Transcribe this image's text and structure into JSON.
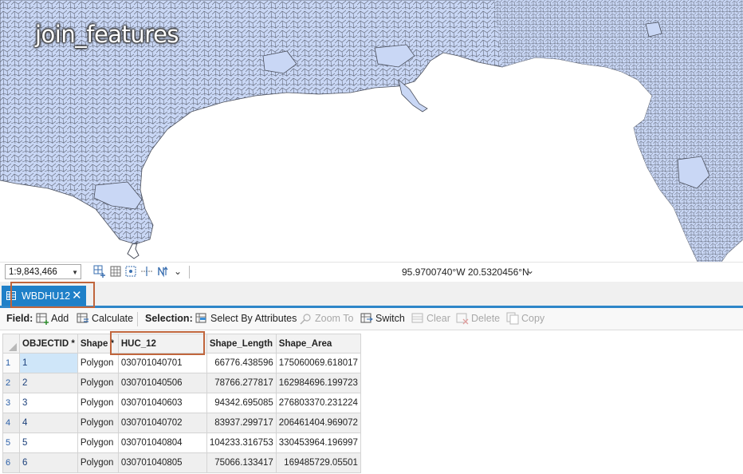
{
  "map": {
    "title": "join_features"
  },
  "statusbar": {
    "scale": "1:9,843,466",
    "coordinates": "95.9700740°W 20.5320456°N"
  },
  "tab": {
    "label": "WBDHU12"
  },
  "toolbar": {
    "field_label": "Field:",
    "add_label": "Add",
    "calculate_label": "Calculate",
    "selection_label": "Selection:",
    "select_by_attributes_label": "Select By Attributes",
    "zoom_to_label": "Zoom To",
    "switch_label": "Switch",
    "clear_label": "Clear",
    "delete_label": "Delete",
    "copy_label": "Copy"
  },
  "table": {
    "columns": [
      "OBJECTID *",
      "Shape *",
      "HUC_12",
      "Shape_Length",
      "Shape_Area"
    ],
    "rows": [
      {
        "row": "1",
        "objectid": "1",
        "shape": "Polygon",
        "huc": "030701040701",
        "length": "66776.438596",
        "area": "175060069.618017"
      },
      {
        "row": "2",
        "objectid": "2",
        "shape": "Polygon",
        "huc": "030701040506",
        "length": "78766.277817",
        "area": "162984696.199723"
      },
      {
        "row": "3",
        "objectid": "3",
        "shape": "Polygon",
        "huc": "030701040603",
        "length": "94342.695085",
        "area": "276803370.231224"
      },
      {
        "row": "4",
        "objectid": "4",
        "shape": "Polygon",
        "huc": "030701040702",
        "length": "83937.299717",
        "area": "206461404.969072"
      },
      {
        "row": "5",
        "objectid": "5",
        "shape": "Polygon",
        "huc": "030701040804",
        "length": "104233.316753",
        "area": "330453964.196997"
      },
      {
        "row": "6",
        "objectid": "6",
        "shape": "Polygon",
        "huc": "030701040805",
        "length": "75066.133417",
        "area": "169485729.05501"
      }
    ]
  },
  "colors": {
    "land_fill": "#c9d7f5",
    "outline": "#4a4f5c",
    "accent": "#1f80c8",
    "highlight_box": "#c0653c"
  }
}
